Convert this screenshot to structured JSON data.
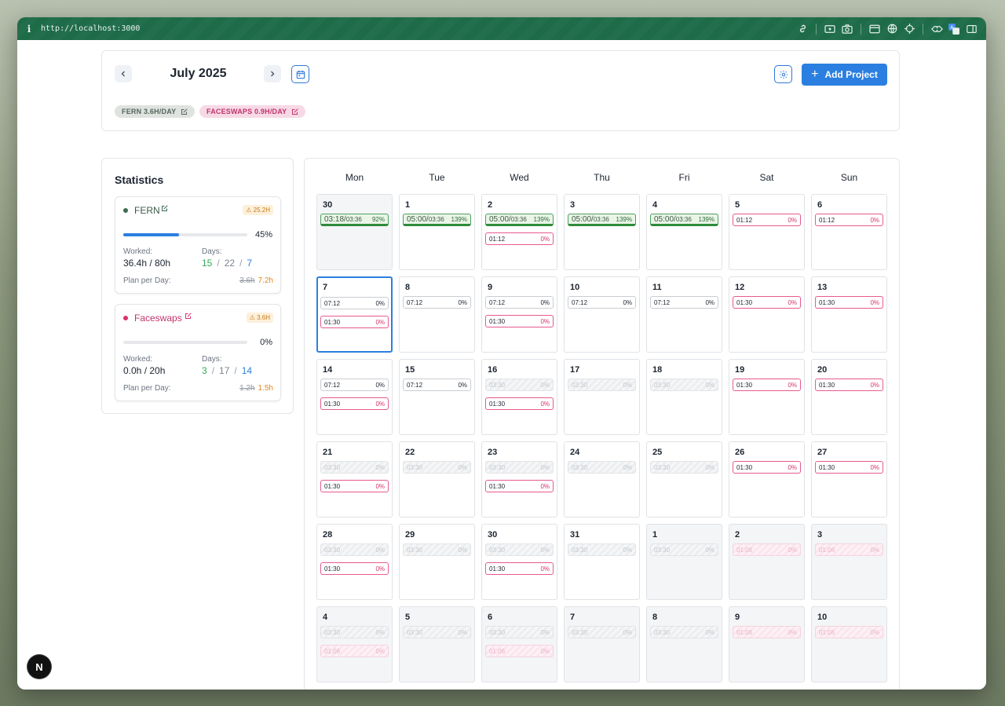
{
  "browser": {
    "info_glyph": "i",
    "url": "http://localhost:3000"
  },
  "header": {
    "month": "July 2025",
    "prev_label": "‹",
    "next_label": "›",
    "add_project": "Add Project",
    "chips": [
      {
        "label": "FERN 3.6H/DAY"
      },
      {
        "label": "FACESWAPS 0.9H/DAY"
      }
    ]
  },
  "stats": {
    "title": "Statistics",
    "projects": [
      {
        "name": "FERN",
        "dot_color": "#3d6b52",
        "name_color": "#3d5a48",
        "warning": "⚠ 25.2H",
        "progress": 45,
        "progress_label": "45%",
        "worked_label": "Worked:",
        "worked": "36.4h / 80h",
        "days_label": "Days:",
        "days_a": "15",
        "days_b": "22",
        "days_c": "7",
        "plan_label": "Plan per Day:",
        "plan_old": "3.6h",
        "plan_new": "7.2h"
      },
      {
        "name": "Faceswaps",
        "dot_color": "#d6336c",
        "name_color": "#c2336b",
        "warning": "⚠ 3.6H",
        "progress": 0,
        "progress_label": "0%",
        "worked_label": "Worked:",
        "worked": "0.0h / 20h",
        "days_label": "Days:",
        "days_a": "3",
        "days_b": "17",
        "days_c": "14",
        "plan_label": "Plan per Day:",
        "plan_old": "1.2h",
        "plan_new": "1.5h"
      }
    ]
  },
  "calendar": {
    "weekdays": [
      "Mon",
      "Tue",
      "Wed",
      "Thu",
      "Fri",
      "Sat",
      "Sun"
    ],
    "weeks": [
      [
        {
          "day": "30",
          "outside": true,
          "entries": [
            {
              "kind": "green",
              "t1": "03:18/",
              "t2": "03:36",
              "p": "92%"
            }
          ]
        },
        {
          "day": "1",
          "entries": [
            {
              "kind": "green",
              "t1": "05:00/",
              "t2": "03:36",
              "p": "139%"
            }
          ]
        },
        {
          "day": "2",
          "entries": [
            {
              "kind": "green",
              "t1": "05:00/",
              "t2": "03:36",
              "p": "139%"
            },
            {
              "kind": "pink",
              "t": "01:12",
              "p": "0%"
            }
          ]
        },
        {
          "day": "3",
          "entries": [
            {
              "kind": "green",
              "t1": "05:00/",
              "t2": "03:36",
              "p": "139%"
            }
          ]
        },
        {
          "day": "4",
          "entries": [
            {
              "kind": "green",
              "t1": "05:00/",
              "t2": "03:36",
              "p": "139%"
            }
          ]
        },
        {
          "day": "5",
          "entries": [
            {
              "kind": "pink",
              "t": "01:12",
              "p": "0%"
            }
          ]
        },
        {
          "day": "6",
          "entries": [
            {
              "kind": "pink",
              "t": "01:12",
              "p": "0%"
            }
          ]
        }
      ],
      [
        {
          "day": "7",
          "today": true,
          "entries": [
            {
              "kind": "plain",
              "t": "07:12",
              "p": "0%"
            },
            {
              "kind": "pink",
              "t": "01:30",
              "p": "0%"
            }
          ]
        },
        {
          "day": "8",
          "entries": [
            {
              "kind": "plain",
              "t": "07:12",
              "p": "0%"
            }
          ]
        },
        {
          "day": "9",
          "entries": [
            {
              "kind": "plain",
              "t": "07:12",
              "p": "0%"
            },
            {
              "kind": "pink",
              "t": "01:30",
              "p": "0%"
            }
          ]
        },
        {
          "day": "10",
          "entries": [
            {
              "kind": "plain",
              "t": "07:12",
              "p": "0%"
            }
          ]
        },
        {
          "day": "11",
          "entries": [
            {
              "kind": "plain",
              "t": "07:12",
              "p": "0%"
            }
          ]
        },
        {
          "day": "12",
          "entries": [
            {
              "kind": "pink",
              "t": "01:30",
              "p": "0%"
            }
          ]
        },
        {
          "day": "13",
          "entries": [
            {
              "kind": "pink",
              "t": "01:30",
              "p": "0%"
            }
          ]
        }
      ],
      [
        {
          "day": "14",
          "entries": [
            {
              "kind": "plain",
              "t": "07:12",
              "p": "0%"
            },
            {
              "kind": "pink",
              "t": "01:30",
              "p": "0%"
            }
          ]
        },
        {
          "day": "15",
          "entries": [
            {
              "kind": "plain",
              "t": "07:12",
              "p": "0%"
            }
          ]
        },
        {
          "day": "16",
          "entries": [
            {
              "kind": "ghost",
              "t": "03:30",
              "p": "0%"
            },
            {
              "kind": "pink",
              "t": "01:30",
              "p": "0%"
            }
          ]
        },
        {
          "day": "17",
          "entries": [
            {
              "kind": "ghost",
              "t": "03:30",
              "p": "0%"
            }
          ]
        },
        {
          "day": "18",
          "entries": [
            {
              "kind": "ghost",
              "t": "03:30",
              "p": "0%"
            }
          ]
        },
        {
          "day": "19",
          "entries": [
            {
              "kind": "pink",
              "t": "01:30",
              "p": "0%"
            }
          ]
        },
        {
          "day": "20",
          "entries": [
            {
              "kind": "pink",
              "t": "01:30",
              "p": "0%"
            }
          ]
        }
      ],
      [
        {
          "day": "21",
          "entries": [
            {
              "kind": "ghost",
              "t": "03:30",
              "p": "0%"
            },
            {
              "kind": "pink",
              "t": "01:30",
              "p": "0%"
            }
          ]
        },
        {
          "day": "22",
          "entries": [
            {
              "kind": "ghost",
              "t": "03:30",
              "p": "0%"
            }
          ]
        },
        {
          "day": "23",
          "entries": [
            {
              "kind": "ghost",
              "t": "03:30",
              "p": "0%"
            },
            {
              "kind": "pink",
              "t": "01:30",
              "p": "0%"
            }
          ]
        },
        {
          "day": "24",
          "entries": [
            {
              "kind": "ghost",
              "t": "03:30",
              "p": "0%"
            }
          ]
        },
        {
          "day": "25",
          "entries": [
            {
              "kind": "ghost",
              "t": "03:30",
              "p": "0%"
            }
          ]
        },
        {
          "day": "26",
          "entries": [
            {
              "kind": "pink",
              "t": "01:30",
              "p": "0%"
            }
          ]
        },
        {
          "day": "27",
          "entries": [
            {
              "kind": "pink",
              "t": "01:30",
              "p": "0%"
            }
          ]
        }
      ],
      [
        {
          "day": "28",
          "entries": [
            {
              "kind": "ghost",
              "t": "03:30",
              "p": "0%"
            },
            {
              "kind": "pink",
              "t": "01:30",
              "p": "0%"
            }
          ]
        },
        {
          "day": "29",
          "entries": [
            {
              "kind": "ghost",
              "t": "03:30",
              "p": "0%"
            }
          ]
        },
        {
          "day": "30",
          "entries": [
            {
              "kind": "ghost",
              "t": "03:30",
              "p": "0%"
            },
            {
              "kind": "pink",
              "t": "01:30",
              "p": "0%"
            }
          ]
        },
        {
          "day": "31",
          "entries": [
            {
              "kind": "ghost",
              "t": "03:30",
              "p": "0%"
            }
          ]
        },
        {
          "day": "1",
          "outside": true,
          "entries": [
            {
              "kind": "ghost",
              "t": "03:30",
              "p": "0%"
            }
          ]
        },
        {
          "day": "2",
          "outside": true,
          "entries": [
            {
              "kind": "ghostpink",
              "t": "01:06",
              "p": "0%"
            }
          ]
        },
        {
          "day": "3",
          "outside": true,
          "entries": [
            {
              "kind": "ghostpink",
              "t": "01:06",
              "p": "0%"
            }
          ]
        }
      ],
      [
        {
          "day": "4",
          "outside": true,
          "entries": [
            {
              "kind": "ghost",
              "t": "03:30",
              "p": "0%"
            },
            {
              "kind": "ghostpink",
              "t": "01:06",
              "p": "0%"
            }
          ]
        },
        {
          "day": "5",
          "outside": true,
          "entries": [
            {
              "kind": "ghost",
              "t": "03:30",
              "p": "0%"
            }
          ]
        },
        {
          "day": "6",
          "outside": true,
          "entries": [
            {
              "kind": "ghost",
              "t": "03:30",
              "p": "0%"
            },
            {
              "kind": "ghostpink",
              "t": "01:06",
              "p": "0%"
            }
          ]
        },
        {
          "day": "7",
          "outside": true,
          "entries": [
            {
              "kind": "ghost",
              "t": "03:30",
              "p": "0%"
            }
          ]
        },
        {
          "day": "8",
          "outside": true,
          "entries": [
            {
              "kind": "ghost",
              "t": "03:30",
              "p": "0%"
            }
          ]
        },
        {
          "day": "9",
          "outside": true,
          "entries": [
            {
              "kind": "ghostpink",
              "t": "01:06",
              "p": "0%"
            }
          ]
        },
        {
          "day": "10",
          "outside": true,
          "entries": [
            {
              "kind": "ghostpink",
              "t": "01:06",
              "p": "0%"
            }
          ]
        }
      ]
    ]
  },
  "devtools": {
    "logo_letter": "N"
  }
}
